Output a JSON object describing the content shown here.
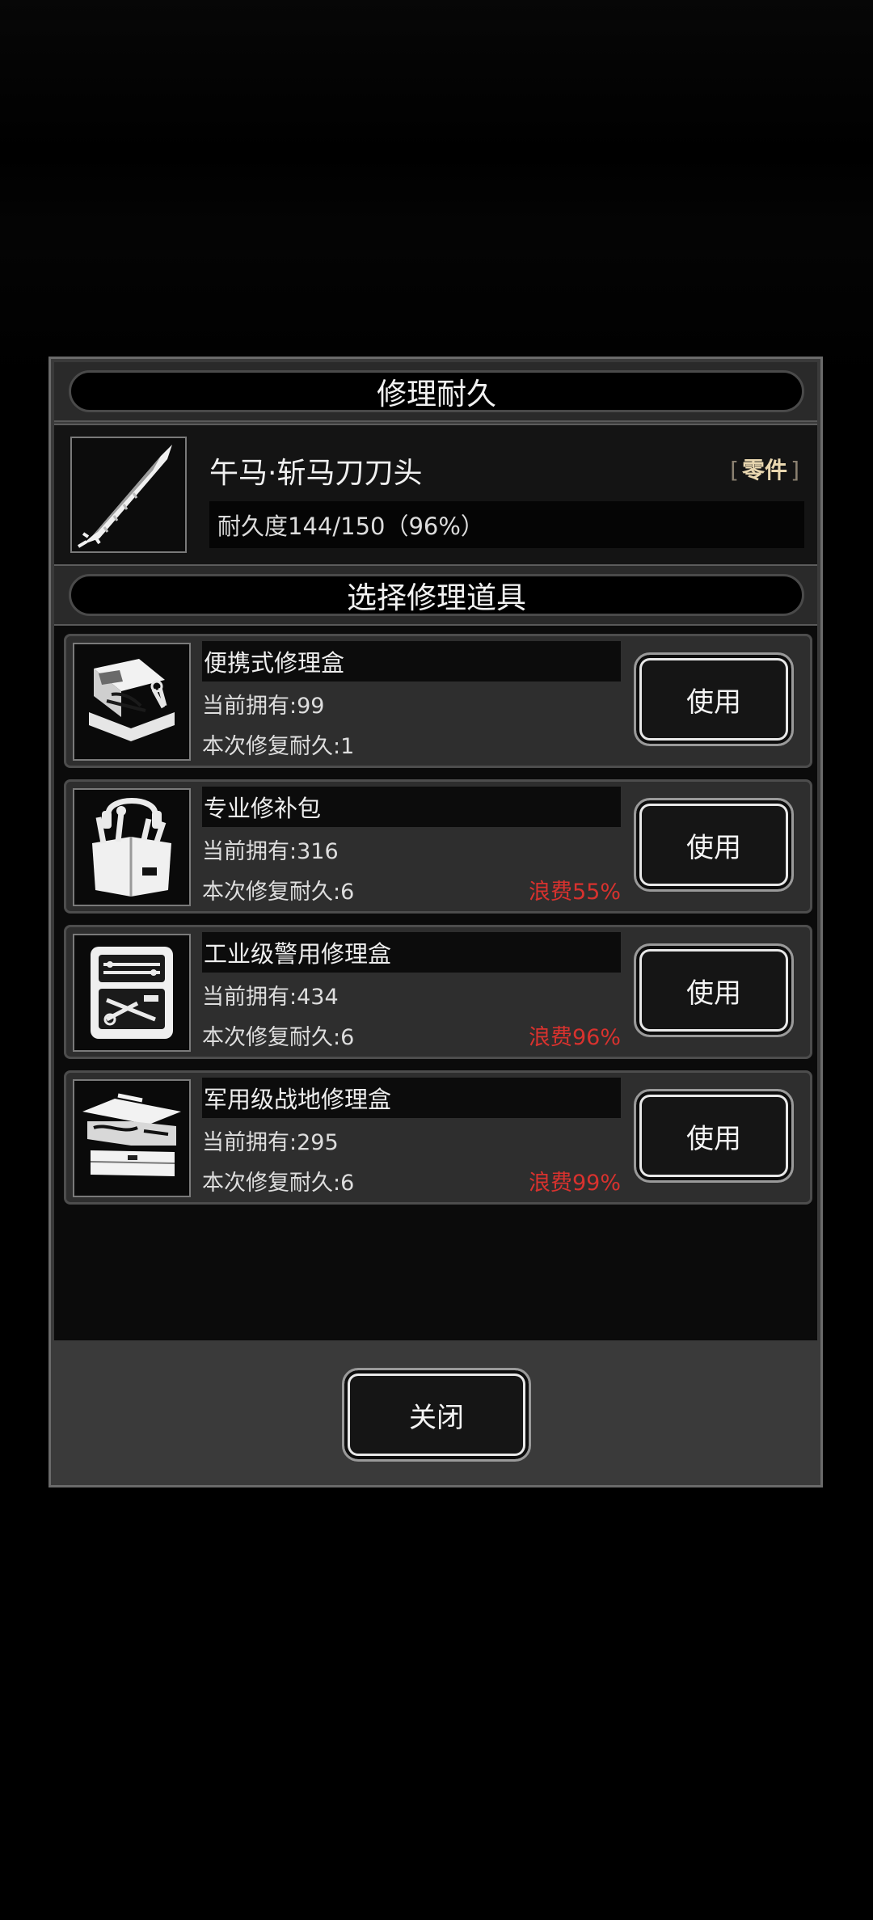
{
  "dialog": {
    "title": "修理耐久",
    "item": {
      "name": "午马·斩马刀刀头",
      "tag_open": "[",
      "tag": "零件",
      "tag_close": "]",
      "durability": "耐久度144/150（96%）",
      "icon": "sword-blade-icon"
    },
    "section_title": "选择修理道具",
    "tools": [
      {
        "name": "便携式修理盒",
        "owned": "当前拥有:99",
        "repair": "本次修复耐久:1",
        "waste": "",
        "use_label": "使用",
        "icon": "portable-repair-box-icon"
      },
      {
        "name": "专业修补包",
        "owned": "当前拥有:316",
        "repair": "本次修复耐久:6",
        "waste": "浪费55%",
        "use_label": "使用",
        "icon": "professional-repair-kit-icon"
      },
      {
        "name": "工业级警用修理盒",
        "owned": "当前拥有:434",
        "repair": "本次修复耐久:6",
        "waste": "浪费96%",
        "use_label": "使用",
        "icon": "industrial-police-repair-box-icon"
      },
      {
        "name": "军用级战地修理盒",
        "owned": "当前拥有:295",
        "repair": "本次修复耐久:6",
        "waste": "浪费99%",
        "use_label": "使用",
        "icon": "military-field-repair-box-icon"
      }
    ],
    "close_label": "关闭",
    "colors": {
      "waste": "#d8322e",
      "tag": "#e9d7b0"
    }
  }
}
